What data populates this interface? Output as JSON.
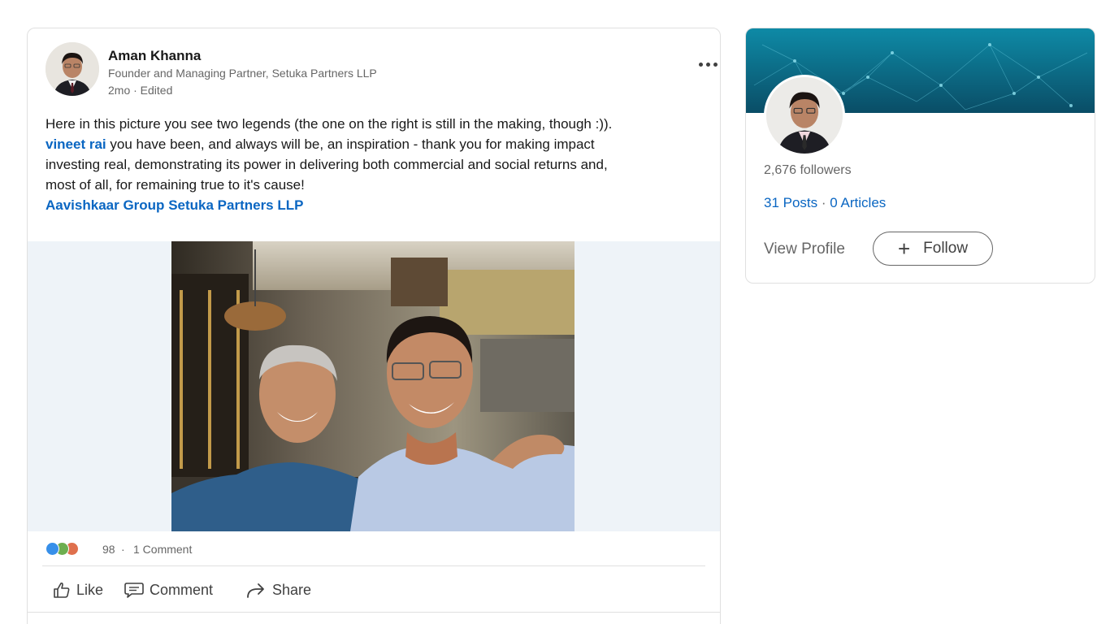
{
  "post": {
    "author_name": "Aman Khanna",
    "author_title": "Founder and Managing Partner, Setuka Partners LLP",
    "meta": "2mo · Edited",
    "more_icon": "ellipsis-icon",
    "text_line1": "Here in this picture you see two legends (the one on the right is still in the making, though :)).",
    "mention": "vineet rai",
    "text_line2_rest": "  you have been, and always will be, an inspiration - thank you for making impact",
    "text_line3": "investing real, demonstrating its power in delivering both commercial and social returns and,",
    "text_line4": "most of all, for remaining true to it's cause!",
    "tags": [
      "Aavishkaar Group",
      "Setuka Partners LLP"
    ],
    "reactions": {
      "icons": [
        "like-reaction-icon",
        "support-reaction-icon",
        "love-reaction-icon"
      ],
      "count": "98",
      "separator": "·",
      "comments": "1 Comment"
    },
    "actions": {
      "like": "Like",
      "comment": "Comment",
      "share": "Share"
    }
  },
  "profile": {
    "followers": "2,676 followers",
    "posts": "31 Posts",
    "dot": "·",
    "articles": "0 Articles",
    "view_profile": "View Profile",
    "follow_plus": "+",
    "follow": "Follow"
  },
  "colors": {
    "link": "#0a66c2",
    "banner": "#0e7f9a",
    "like": "#378fe9",
    "support": "#6dae4f",
    "love": "#df704d"
  }
}
